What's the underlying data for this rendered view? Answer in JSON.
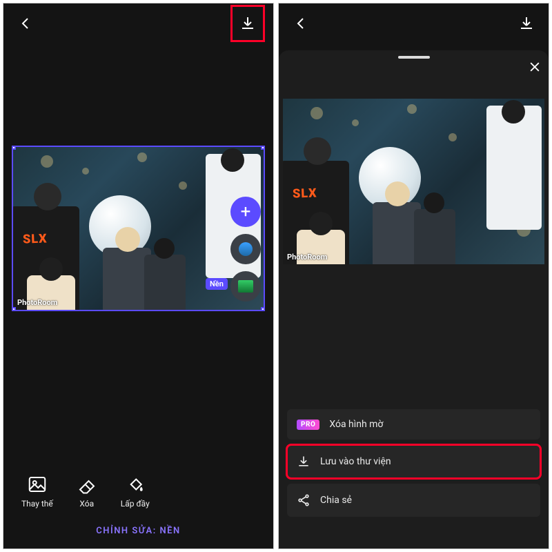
{
  "watermark": "PhotoRoom",
  "left": {
    "layer_tag": "Nền",
    "tools": {
      "replace": "Thay thế",
      "erase": "Xóa",
      "fill": "Lấp đầy"
    },
    "footer": "CHỈNH SỬA: NỀN",
    "shirt_logo": "SLX"
  },
  "right": {
    "options": {
      "pro_badge": "PRO",
      "remove_watermark": "Xóa hình mờ",
      "save_to_library": "Lưu vào thư viện",
      "share": "Chia sẻ"
    }
  }
}
